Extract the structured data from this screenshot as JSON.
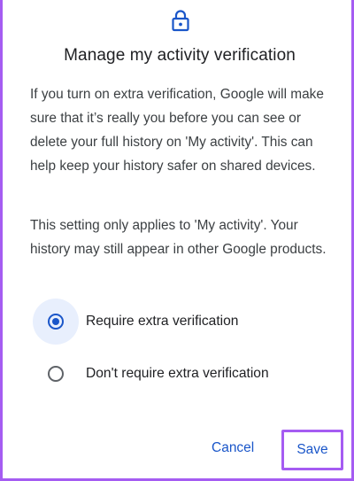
{
  "dialog": {
    "title": "Manage my activity verification",
    "icon": "lock-icon",
    "paragraph1": "If you turn on extra verification, Google will make sure that it’s really you before you can see or delete your full history on 'My activity'. This can help keep your history safer on shared devices.",
    "paragraph2": "This setting only applies to 'My activity'. Your history may still appear in other Google products.",
    "options": [
      {
        "label": "Require extra verification",
        "selected": true
      },
      {
        "label": "Don't require extra verification",
        "selected": false
      }
    ],
    "cancel_label": "Cancel",
    "save_label": "Save"
  },
  "colors": {
    "accent": "#1a56c9",
    "highlight_border": "#a55cf2",
    "selected_bg": "#e8effd"
  }
}
